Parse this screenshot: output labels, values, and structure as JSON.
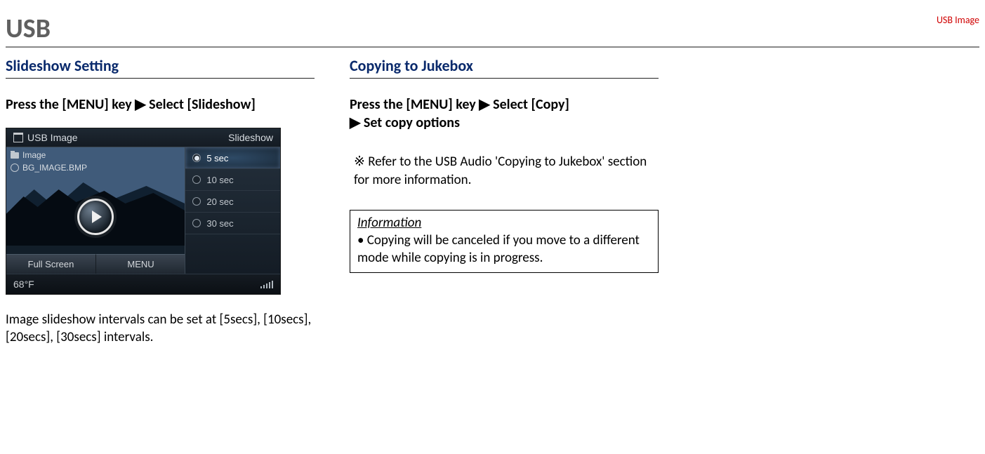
{
  "header_tag": "USB Image",
  "page_title": "USB",
  "col1": {
    "heading": "Slideshow Setting",
    "instruction_pre": "Press the [MENU] key ",
    "instruction_post": " Select [Slideshow]",
    "body": "Image slideshow intervals can be set at [5secs], [10secs], [20secs], [30secs] intervals."
  },
  "col2": {
    "heading": "Copying to Jukebox",
    "instr_1": "Press the [MENU] key ",
    "instr_2": " Select [Copy] ",
    "instr_3": " Set copy options",
    "note": "※ Refer to the USB Audio 'Copying to Jukebox' section for more information.",
    "info_title": "Information",
    "info_body": "• Copying will be canceled if you move to a different mode while copying is in progress."
  },
  "screen": {
    "topbar_left": "USB Image",
    "topbar_right": "Slideshow",
    "list_folder": "Image",
    "list_file": "BG_IMAGE.BMP",
    "softkey_left": "Full Screen",
    "softkey_right": "MENU",
    "options": [
      "5 sec",
      "10 sec",
      "20 sec",
      "30 sec"
    ],
    "selected_option": "5 sec",
    "status_temp": "68°F"
  },
  "arrow_glyph": "▶"
}
